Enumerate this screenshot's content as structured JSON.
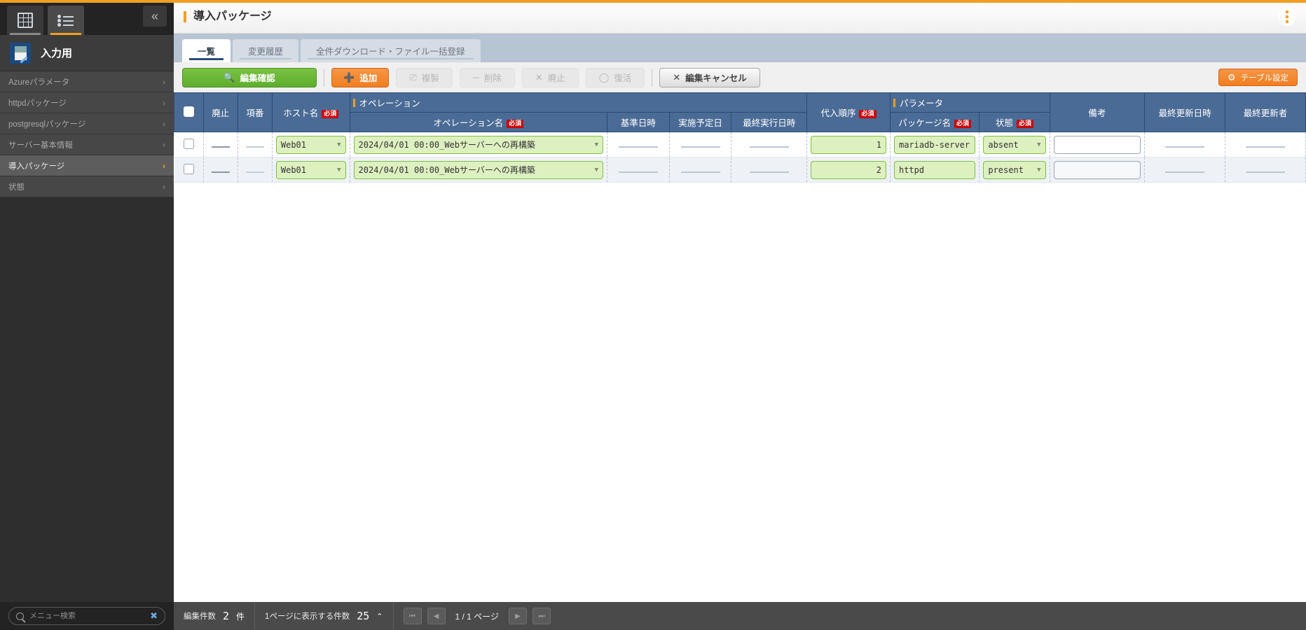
{
  "sidebar": {
    "tabs": [
      {
        "name": "grid-view-tab",
        "icon": "grid-icon",
        "active": false
      },
      {
        "name": "list-view-tab",
        "icon": "list-icon",
        "active": true
      }
    ],
    "collapse_label": "«",
    "menu_title": "入力用",
    "items": [
      {
        "label": "Azureパラメータ",
        "active": false
      },
      {
        "label": "httpdパッケージ",
        "active": false
      },
      {
        "label": "postgresqlパッケージ",
        "active": false
      },
      {
        "label": "サーバー基本情報",
        "active": false
      },
      {
        "label": "導入パッケージ",
        "active": true
      },
      {
        "label": "状態",
        "active": false
      }
    ],
    "chevron": "›",
    "search_placeholder": "メニュー検索",
    "search_value": "",
    "clear_label": "✖"
  },
  "header": {
    "title": "導入パッケージ",
    "accent_color": "#f0a020"
  },
  "tabs": [
    {
      "label": "一覧",
      "active": true
    },
    {
      "label": "変更履歴",
      "active": false
    },
    {
      "label": "全件ダウンロード・ファイル一括登録",
      "active": false
    }
  ],
  "toolbar": {
    "confirm_edit": "編集確認",
    "add": "追加",
    "duplicate": "複製",
    "delete": "削除",
    "abolish": "廃止",
    "restore": "復活",
    "cancel_edit": "編集キャンセル",
    "table_settings": "テーブル設定"
  },
  "table": {
    "group_headers": [
      {
        "label": "オペレーション"
      },
      {
        "label": "パラメータ"
      }
    ],
    "columns": {
      "abolish": "廃止",
      "seq": "項番",
      "hostname": "ホスト名",
      "operation_name": "オペレーション名",
      "base_datetime": "基準日時",
      "planned_date": "実施予定日",
      "last_exec_datetime": "最終実行日時",
      "assign_order": "代入順序",
      "package_name": "パッケージ名",
      "state": "状態",
      "remarks": "備考",
      "last_update_datetime": "最終更新日時",
      "last_updater": "最終更新者"
    },
    "required_badge": "必須",
    "rows": [
      {
        "checked": false,
        "abolish": "—",
        "seq": "—",
        "hostname": "Web01",
        "operation_name": "2024/04/01 00:00_Webサーバーへの再構築",
        "base_datetime": "",
        "planned_date": "",
        "last_exec_datetime": "",
        "assign_order": "1",
        "package_name": "mariadb-server",
        "state": "absent",
        "remarks": "",
        "last_update_datetime": "",
        "last_updater": ""
      },
      {
        "checked": false,
        "abolish": "—",
        "seq": "—",
        "hostname": "Web01",
        "operation_name": "2024/04/01 00:00_Webサーバーへの再構築",
        "base_datetime": "",
        "planned_date": "",
        "last_exec_datetime": "",
        "assign_order": "2",
        "package_name": "httpd",
        "state": "present",
        "remarks": "",
        "last_update_datetime": "",
        "last_updater": ""
      }
    ]
  },
  "statusbar": {
    "edit_count_label": "編集件数",
    "edit_count_value": "2",
    "edit_count_unit": "件",
    "per_page_label": "1ページに表示する件数",
    "per_page_value": "25",
    "per_page_caret": "⌃",
    "page_text": "1 / 1 ページ",
    "first_label": "⏮",
    "prev_label": "◀",
    "next_label": "▶",
    "last_label": "⏭"
  }
}
